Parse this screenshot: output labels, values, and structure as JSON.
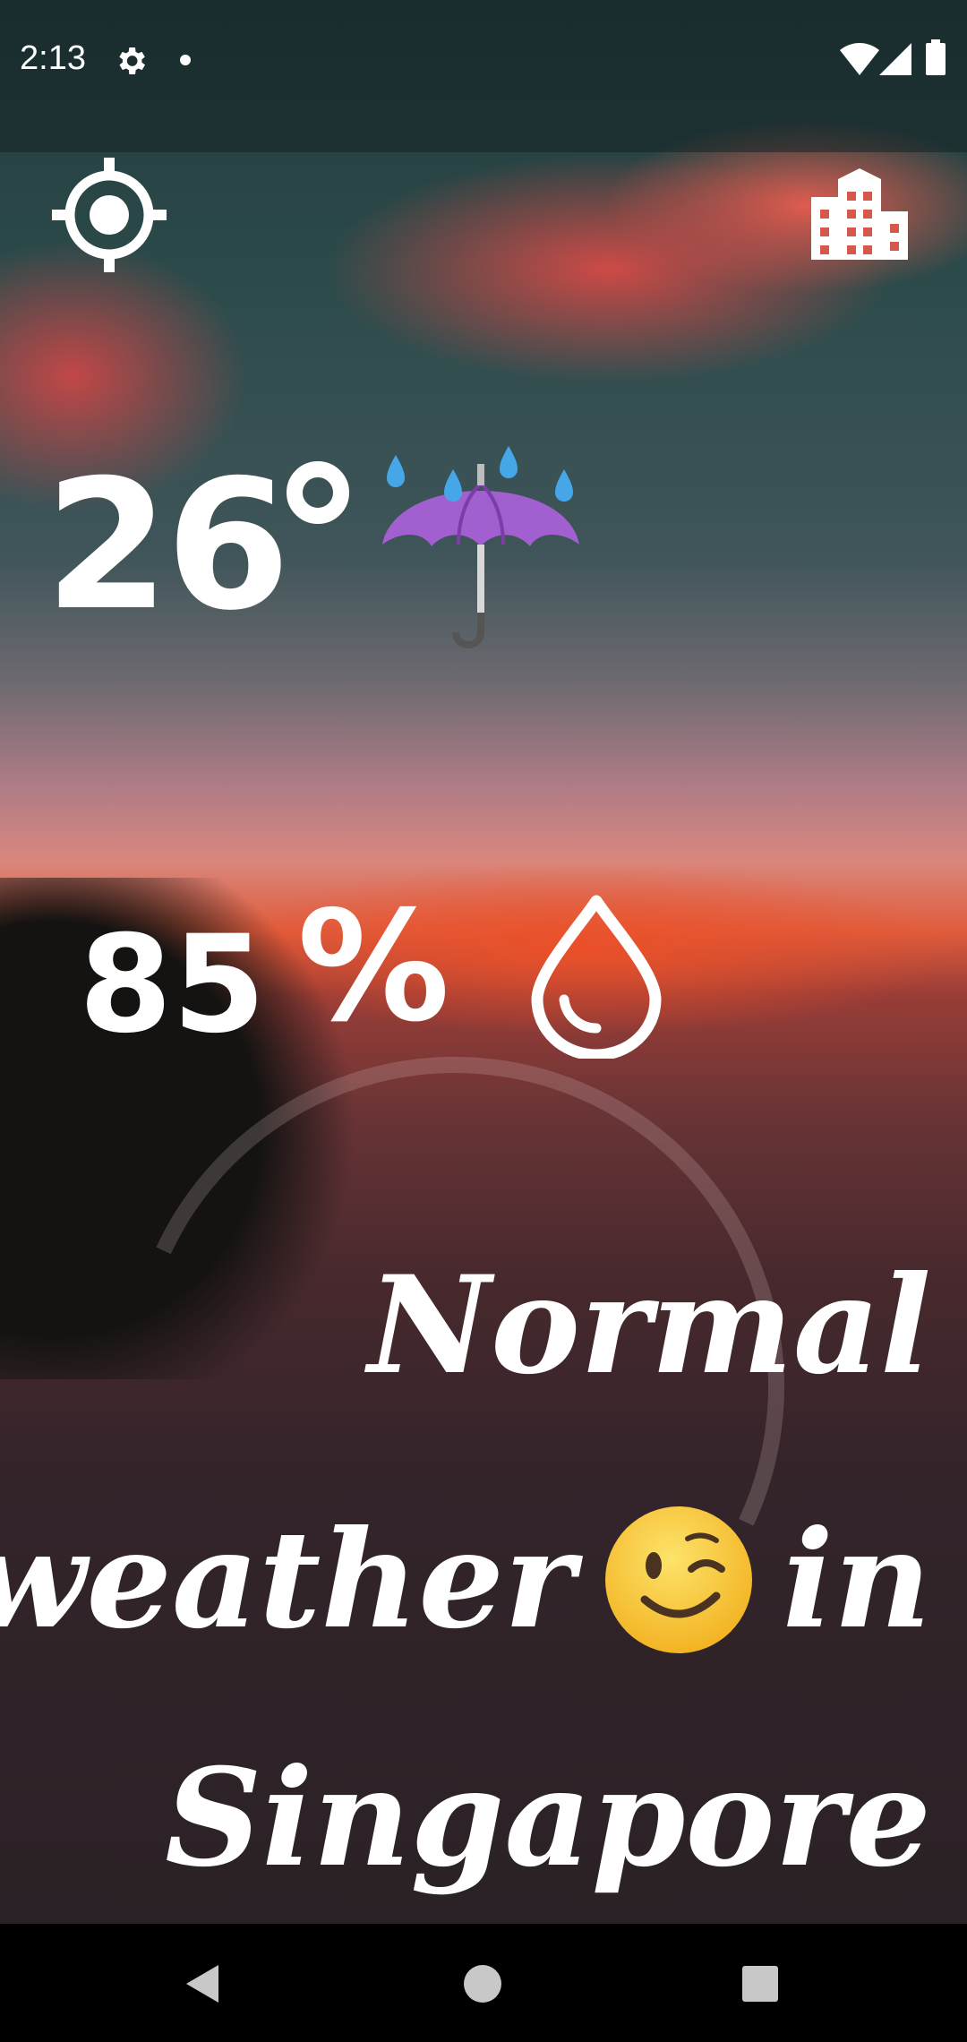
{
  "status_bar": {
    "time": "2:13",
    "icons": [
      "gear-icon",
      "dot-icon",
      "wifi-icon",
      "signal-icon",
      "battery-icon"
    ]
  },
  "toolbar": {
    "location_button_icon": "gps-crosshair-icon",
    "city_button_icon": "city-building-icon"
  },
  "weather": {
    "temperature": "26",
    "condition_icon": "umbrella-with-rain-icon",
    "humidity": "85",
    "humidity_unit": "%",
    "humidity_icon": "water-drop-icon"
  },
  "message": {
    "line1": "Normal",
    "line2_word": "weather",
    "line2_emoji": "winking-face-icon",
    "line2_suffix": "in",
    "line3": "Singapore"
  },
  "nav_bar": {
    "icons": [
      "back-triangle-icon",
      "home-circle-icon",
      "recents-square-icon"
    ]
  },
  "colors": {
    "text": "#ffffff",
    "umbrella": "#a25fcf",
    "raindrop": "#46a7e8",
    "emoji": "#f4c22e"
  }
}
